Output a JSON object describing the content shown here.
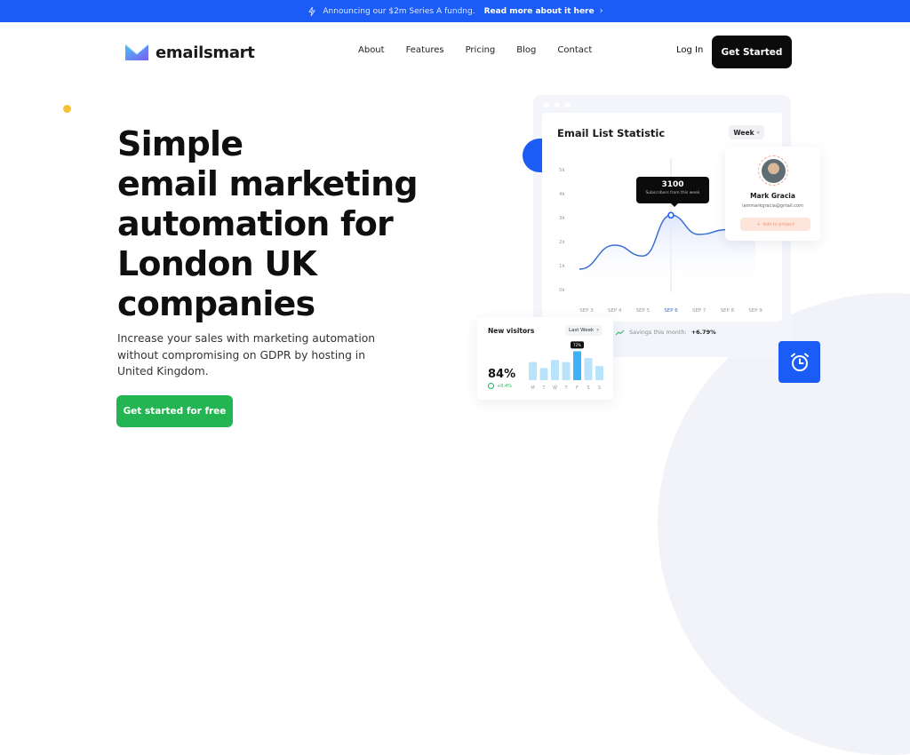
{
  "announcement": {
    "text": "Announcing our $2m Series A fundng.",
    "link": "Read more about it here",
    "icon": "lightning-icon"
  },
  "nav": {
    "brand": "emailsmart",
    "items": [
      "About",
      "Features",
      "Pricing",
      "Blog",
      "Contact"
    ],
    "login": "Log In",
    "cta": "Get Started"
  },
  "hero": {
    "title_lines": [
      "Simple",
      "email marketing",
      "automation for",
      "London UK",
      "companies"
    ],
    "subtitle": "Increase your sales with marketing automation without compromising on GDPR by hosting in United Kingdom.",
    "cta": "Get started for free"
  },
  "dashboard": {
    "chart_title": "Email List Statistic",
    "period": "Week",
    "tooltip_value": "3100",
    "tooltip_label": "Subscribers from this week",
    "profile": {
      "name": "Mark Gracia",
      "email": "iammarkgracia@gmail.com",
      "button": "Add to project"
    },
    "visitors": {
      "title": "New visitors",
      "period": "Last Week",
      "percent": "84%",
      "delta": "+0.4%",
      "highlight_label": "72%"
    },
    "savings_label": "Savings this month:",
    "savings_value": "+6.79%"
  },
  "chart_data": [
    {
      "type": "line",
      "title": "Email List Statistic",
      "x": [
        "SEP 3",
        "SEP 4",
        "SEP 5",
        "SEP 6",
        "SEP 7",
        "SEP 8",
        "SEP 9"
      ],
      "y_ticks": [
        "0k",
        "1k",
        "2k",
        "3k",
        "4k",
        "5k"
      ],
      "ylim": [
        0,
        5000
      ],
      "highlight": "SEP 6",
      "series": [
        {
          "name": "Subscribers",
          "values": [
            850,
            1850,
            1400,
            3100,
            2300,
            2500,
            2500
          ]
        }
      ]
    },
    {
      "type": "bar",
      "title": "New visitors",
      "categories": [
        "M",
        "T",
        "W",
        "T",
        "F",
        "S",
        "S"
      ],
      "values": [
        45,
        30,
        50,
        45,
        72,
        55,
        35
      ],
      "highlight": "F"
    }
  ]
}
